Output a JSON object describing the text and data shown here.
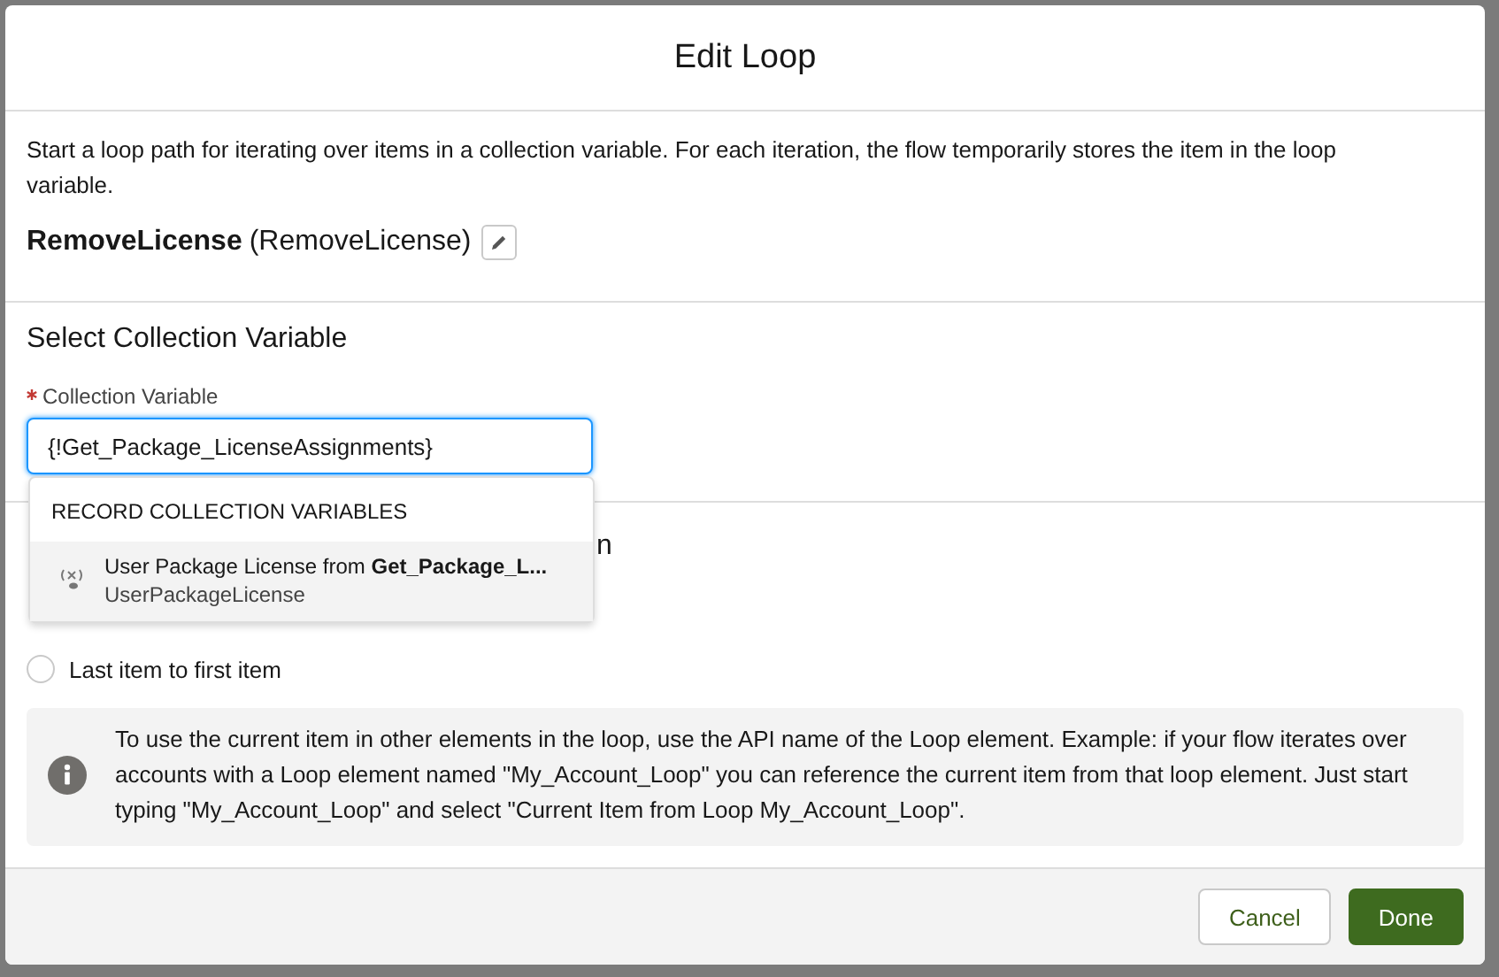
{
  "modal": {
    "title": "Edit Loop"
  },
  "description": "Start a loop path for iterating over items in a collection variable. For each iteration, the flow temporarily stores the item in the loop variable.",
  "element": {
    "label": "RemoveLicense",
    "api_name": "(RemoveLicense)"
  },
  "collection_section": {
    "title": "Select Collection Variable",
    "field": {
      "label": "Collection Variable",
      "required": true,
      "value": "{!Get_Package_LicenseAssignments}"
    }
  },
  "dropdown": {
    "group": "RECORD COLLECTION VARIABLES",
    "options": [
      {
        "title": "User Package License from **Get_Package_L...**",
        "subtitle": "UserPackageLicense",
        "selected": true
      }
    ]
  },
  "direction_section": {
    "title_visible": "n",
    "options": [
      {
        "label": "Last item to first item",
        "selected": false
      }
    ]
  },
  "info": "To use the current item in other elements in the loop, use the API name of the Loop element. Example: if your flow iterates over accounts with a Loop element named \"My_Account_Loop\" you can reference the current item from that loop element. Just start typing \"My_Account_Loop\" and select \"Current Item from Loop My_Account_Loop\".",
  "buttons": [
    {
      "label": "Cancel",
      "kind": "neutral"
    },
    {
      "label": "Done",
      "kind": "brand"
    }
  ]
}
